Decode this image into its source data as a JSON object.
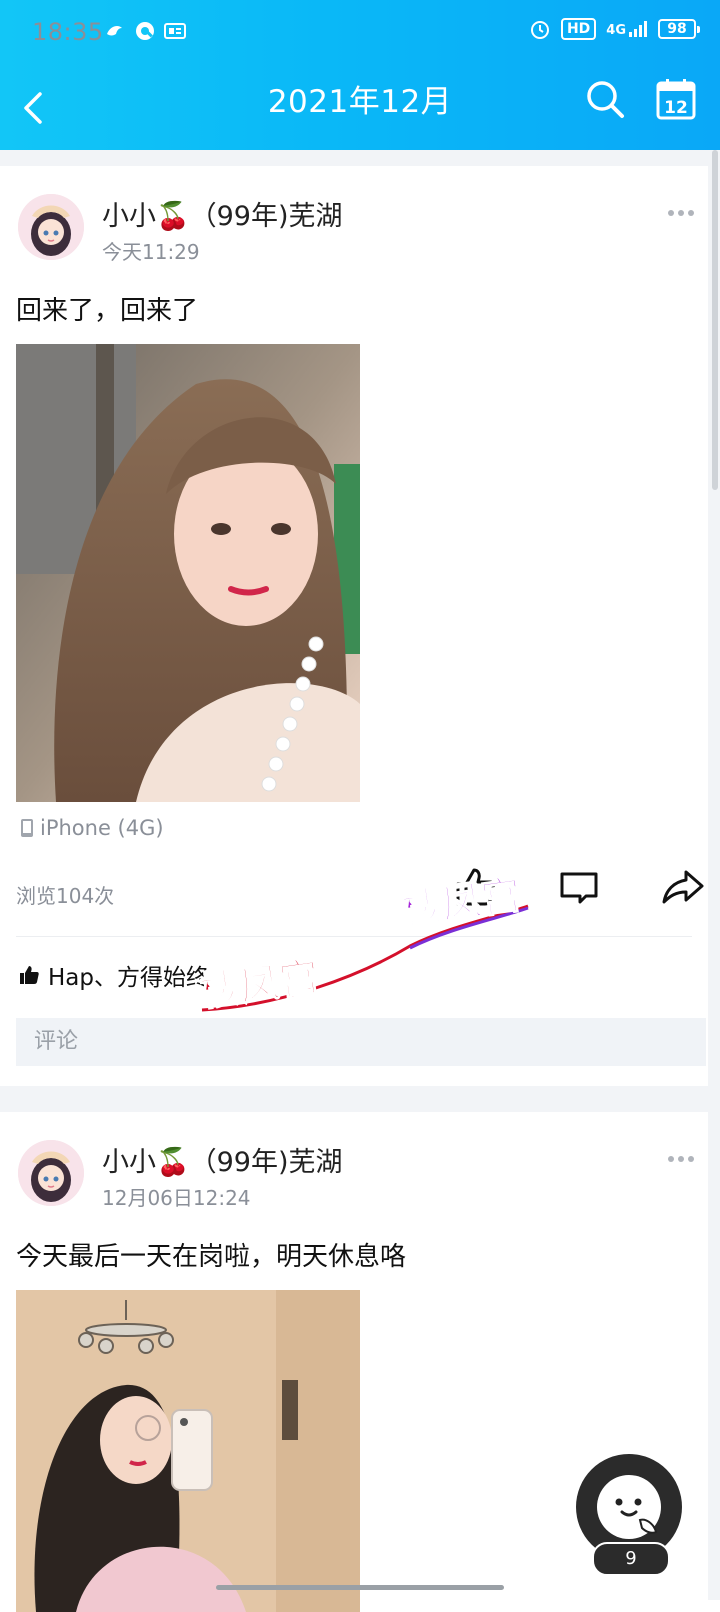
{
  "status_bar": {
    "time": "18:35",
    "hd_label": "HD",
    "network_label": "4G",
    "battery_level": "98"
  },
  "nav": {
    "title": "2021年12月"
  },
  "posts": [
    {
      "author": "小小🍒（99年)芜湖",
      "time": "今天11:29",
      "text": "回来了，回来了",
      "device": "iPhone (4G)",
      "views": "浏览104次",
      "likes_text": "Hap、方得始终",
      "comment_placeholder": "评论"
    },
    {
      "author": "小小🍒（99年)芜湖",
      "time": "12月06日12:24",
      "text": "今天最后一天在岗啦，明天休息咯"
    }
  ],
  "watermark": {
    "text_top": "楼凤宫",
    "text_bottom": "楼凤宫"
  },
  "floating_button": {
    "count": "9"
  },
  "colors": {
    "header_start": "#12c6f7",
    "header_end": "#0aa8f7",
    "muted_text": "#8a8f98",
    "comment_bg": "#f0f3f7"
  }
}
